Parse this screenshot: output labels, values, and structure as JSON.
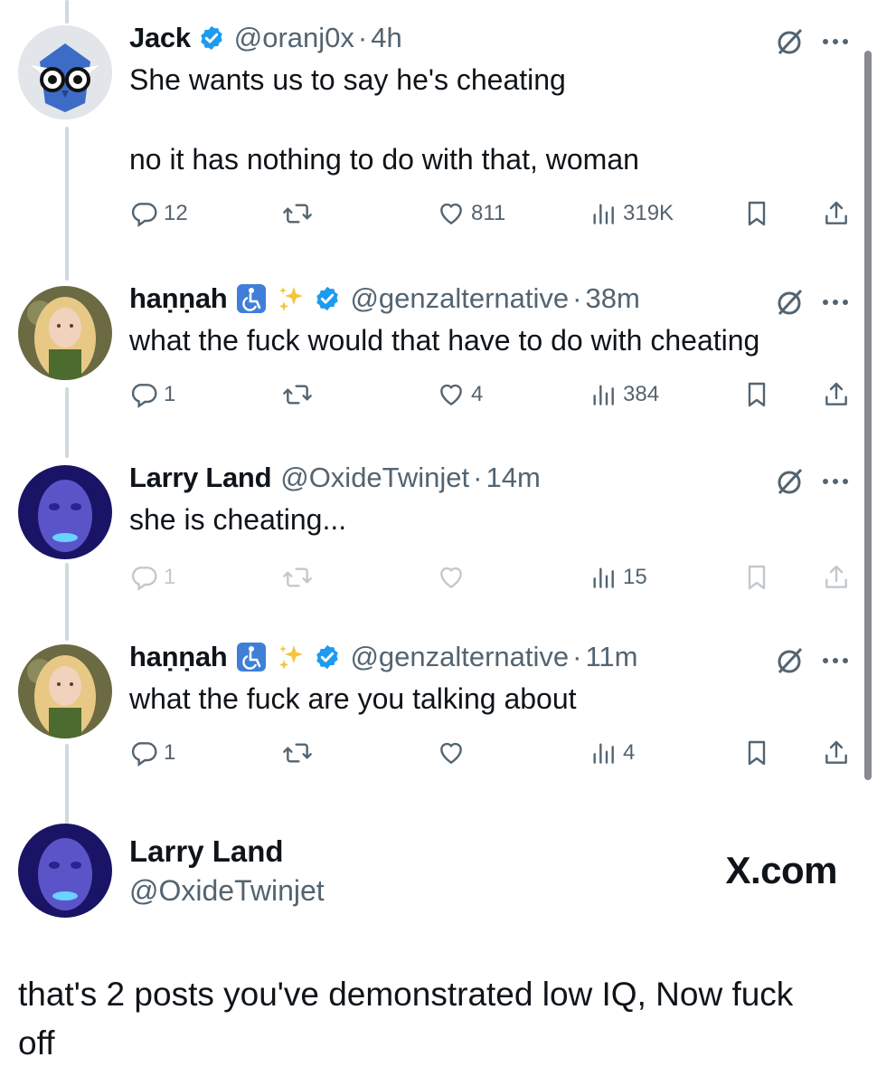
{
  "colors": {
    "accent": "#1d9bf0",
    "muted": "#536471",
    "line": "#cfd9de"
  },
  "tweets": [
    {
      "name": "Jack",
      "handle": "@oranj0x",
      "dot": "·",
      "time": "4h",
      "text": "She wants us to say he's cheating\n\nno it has nothing to do with that, woman",
      "replies": "12",
      "reposts": "",
      "likes": "811",
      "views": "319K",
      "verified": true,
      "emoji": false
    },
    {
      "name": "haṇṇah",
      "handle": "@genzalternative",
      "dot": "·",
      "time": "38m",
      "text": "what the fuck would that have to do with cheating",
      "replies": "1",
      "reposts": "",
      "likes": "4",
      "views": "384",
      "verified": true,
      "emoji": true
    },
    {
      "name": "Larry Land",
      "handle": "@OxideTwinjet",
      "dot": "·",
      "time": "14m",
      "text": "she is cheating...",
      "replies": "1",
      "reposts": "",
      "likes": "",
      "views": "15",
      "verified": false,
      "emoji": false
    },
    {
      "name": "haṇṇah",
      "handle": "@genzalternative",
      "dot": "·",
      "time": "11m",
      "text": "what the fuck are you talking about",
      "replies": "1",
      "reposts": "",
      "likes": "",
      "views": "4",
      "verified": true,
      "emoji": true
    }
  ],
  "final": {
    "name": "Larry Land",
    "handle": "@OxideTwinjet",
    "brand": "X.com",
    "text": "that's 2 posts you've demonstrated low IQ, Now fuck off"
  }
}
